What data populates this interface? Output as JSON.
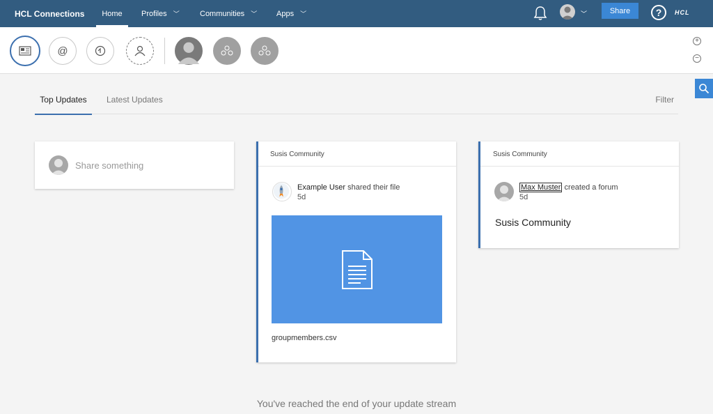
{
  "header": {
    "brand": "HCL Connections",
    "nav": [
      {
        "label": "Home"
      },
      {
        "label": "Profiles"
      },
      {
        "label": "Communities"
      },
      {
        "label": "Apps"
      }
    ],
    "share_label": "Share",
    "help_label": "?",
    "logo_text": "HCL"
  },
  "filters": {
    "mention_glyph": "@",
    "icons": [
      "news-feed-icon",
      "mentions-icon",
      "status-updates-icon",
      "add-person-icon",
      "person-icon",
      "community-icon",
      "community-icon"
    ],
    "zoom_in": "+",
    "zoom_out": "−"
  },
  "tabs": {
    "top": "Top Updates",
    "latest": "Latest Updates",
    "filter": "Filter"
  },
  "share_box": {
    "placeholder": "Share something"
  },
  "cards": [
    {
      "community": "Susis Community",
      "actor": "Example User",
      "action": "shared their file",
      "age": "5d",
      "file_name": "groupmembers.csv"
    },
    {
      "community": "Susis Community",
      "actor": "Max Muster",
      "action": "created a forum",
      "age": "5d",
      "forum_title": "Susis Community"
    }
  ],
  "end_message": "You've reached the end of your update stream",
  "colors": {
    "nav_bg": "#325c80",
    "accent": "#3b87d5",
    "file_tile": "#5194e4"
  }
}
